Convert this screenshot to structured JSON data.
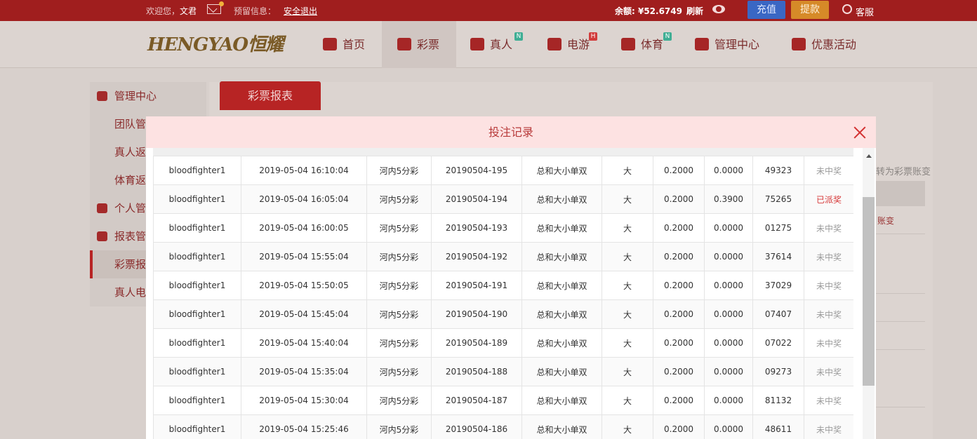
{
  "topbar": {
    "welcome_prefix": "欢迎您，",
    "username": "文君",
    "announcement_label": "预留信息：",
    "logout": "安全退出",
    "balance": "余额: ¥52.6749",
    "refresh": "刷新",
    "charge": "充值",
    "withdraw": "提款",
    "service": "客服"
  },
  "logo": {
    "text": "HENGYAO恒耀"
  },
  "nav": {
    "home": "首页",
    "lottery": "彩票",
    "live": "真人",
    "slots": "电游",
    "sports": "体育",
    "management": "管理中心",
    "promotions": "优惠活动",
    "badges": {
      "live": "N",
      "slots": "H",
      "sports": "N"
    }
  },
  "sidebar": {
    "head1": "管理中心",
    "item1": "团队管",
    "item2": "真人返",
    "item3": "体育返",
    "head2": "个人管",
    "head3": "报表管",
    "active": "彩票报",
    "item4": "真人电"
  },
  "tab": {
    "title": "彩票报表"
  },
  "right_bg": {
    "note": "转为彩票账变",
    "cell": "账变"
  },
  "modal": {
    "title": "投注记录",
    "rows": [
      {
        "user": "bloodfighter1",
        "time": "2019-05-04 16:10:04",
        "game": "河内5分彩",
        "issue": "20190504-195",
        "play": "总和大小单双",
        "bet": "大",
        "amount": "0.2000",
        "prize": "0.0000",
        "number": "49323",
        "status": "未中奖",
        "won": false
      },
      {
        "user": "bloodfighter1",
        "time": "2019-05-04 16:05:04",
        "game": "河内5分彩",
        "issue": "20190504-194",
        "play": "总和大小单双",
        "bet": "大",
        "amount": "0.2000",
        "prize": "0.3900",
        "number": "75265",
        "status": "已派奖",
        "won": true
      },
      {
        "user": "bloodfighter1",
        "time": "2019-05-04 16:00:05",
        "game": "河内5分彩",
        "issue": "20190504-193",
        "play": "总和大小单双",
        "bet": "大",
        "amount": "0.2000",
        "prize": "0.0000",
        "number": "01275",
        "status": "未中奖",
        "won": false
      },
      {
        "user": "bloodfighter1",
        "time": "2019-05-04 15:55:04",
        "game": "河内5分彩",
        "issue": "20190504-192",
        "play": "总和大小单双",
        "bet": "大",
        "amount": "0.2000",
        "prize": "0.0000",
        "number": "37614",
        "status": "未中奖",
        "won": false
      },
      {
        "user": "bloodfighter1",
        "time": "2019-05-04 15:50:05",
        "game": "河内5分彩",
        "issue": "20190504-191",
        "play": "总和大小单双",
        "bet": "大",
        "amount": "0.2000",
        "prize": "0.0000",
        "number": "37029",
        "status": "未中奖",
        "won": false
      },
      {
        "user": "bloodfighter1",
        "time": "2019-05-04 15:45:04",
        "game": "河内5分彩",
        "issue": "20190504-190",
        "play": "总和大小单双",
        "bet": "大",
        "amount": "0.2000",
        "prize": "0.0000",
        "number": "07407",
        "status": "未中奖",
        "won": false
      },
      {
        "user": "bloodfighter1",
        "time": "2019-05-04 15:40:04",
        "game": "河内5分彩",
        "issue": "20190504-189",
        "play": "总和大小单双",
        "bet": "大",
        "amount": "0.2000",
        "prize": "0.0000",
        "number": "07022",
        "status": "未中奖",
        "won": false
      },
      {
        "user": "bloodfighter1",
        "time": "2019-05-04 15:35:04",
        "game": "河内5分彩",
        "issue": "20190504-188",
        "play": "总和大小单双",
        "bet": "大",
        "amount": "0.2000",
        "prize": "0.0000",
        "number": "09273",
        "status": "未中奖",
        "won": false
      },
      {
        "user": "bloodfighter1",
        "time": "2019-05-04 15:30:04",
        "game": "河内5分彩",
        "issue": "20190504-187",
        "play": "总和大小单双",
        "bet": "大",
        "amount": "0.2000",
        "prize": "0.0000",
        "number": "81132",
        "status": "未中奖",
        "won": false
      },
      {
        "user": "bloodfighter1",
        "time": "2019-05-04 15:25:46",
        "game": "河内5分彩",
        "issue": "20190504-186",
        "play": "总和大小单双",
        "bet": "大",
        "amount": "0.2000",
        "prize": "0.0000",
        "number": "48611",
        "status": "未中奖",
        "won": false
      }
    ]
  },
  "colors": {
    "brand_red": "#a01e1e",
    "won": "#d63737",
    "lost": "#9b9b9b",
    "modal_header": "#fde2e2"
  },
  "icons": [
    "mail-icon",
    "eye-icon",
    "service-icon",
    "home-icon",
    "lottery-icon",
    "live-icon",
    "slots-icon",
    "sports-icon",
    "management-icon",
    "gift-icon",
    "close-icon",
    "scroll-up-icon"
  ]
}
